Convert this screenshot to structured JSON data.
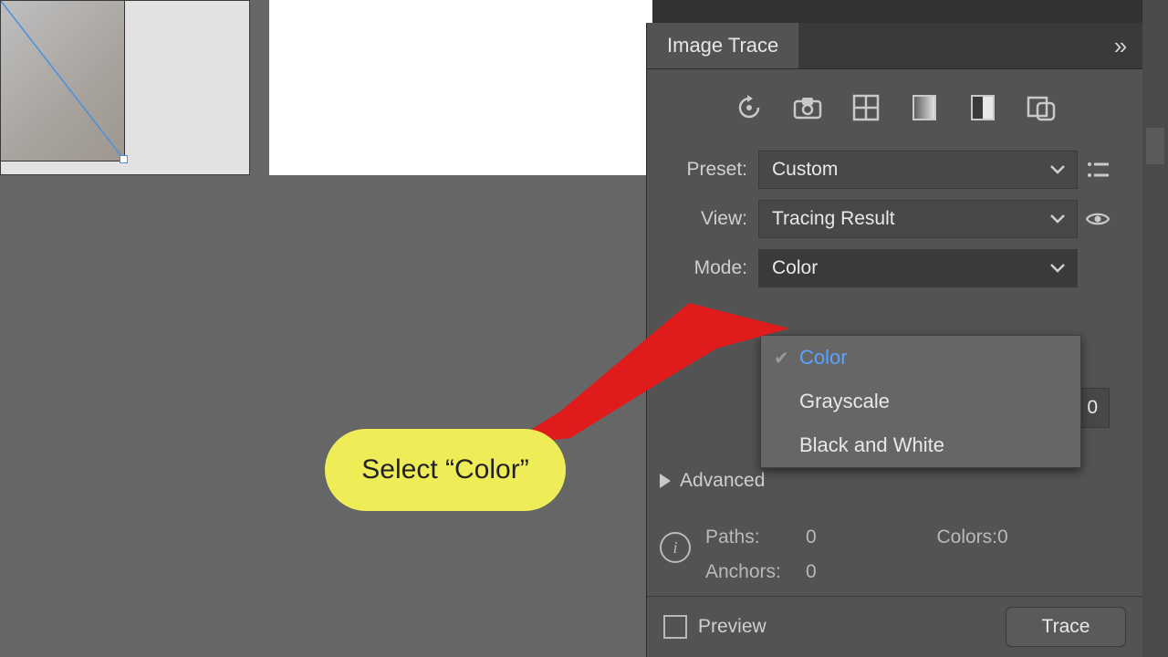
{
  "panel": {
    "title": "Image Trace",
    "collapse_glyph": "»",
    "preset_label": "Preset:",
    "preset_value": "Custom",
    "view_label": "View:",
    "view_value": "Tracing Result",
    "mode_label": "Mode:",
    "mode_value": "Color",
    "mode_options": [
      {
        "label": "Color",
        "selected": true
      },
      {
        "label": "Grayscale",
        "selected": false
      },
      {
        "label": "Black and White",
        "selected": false
      }
    ],
    "hidden_numeric_value": "0",
    "advanced_label": "Advanced",
    "stats": {
      "paths_label": "Paths:",
      "paths_value": "0",
      "colors_label": "Colors:",
      "colors_value": "0",
      "anchors_label": "Anchors:",
      "anchors_value": "0"
    },
    "preview_label": "Preview",
    "trace_label": "Trace"
  },
  "callout": {
    "text": "Select “Color”"
  }
}
